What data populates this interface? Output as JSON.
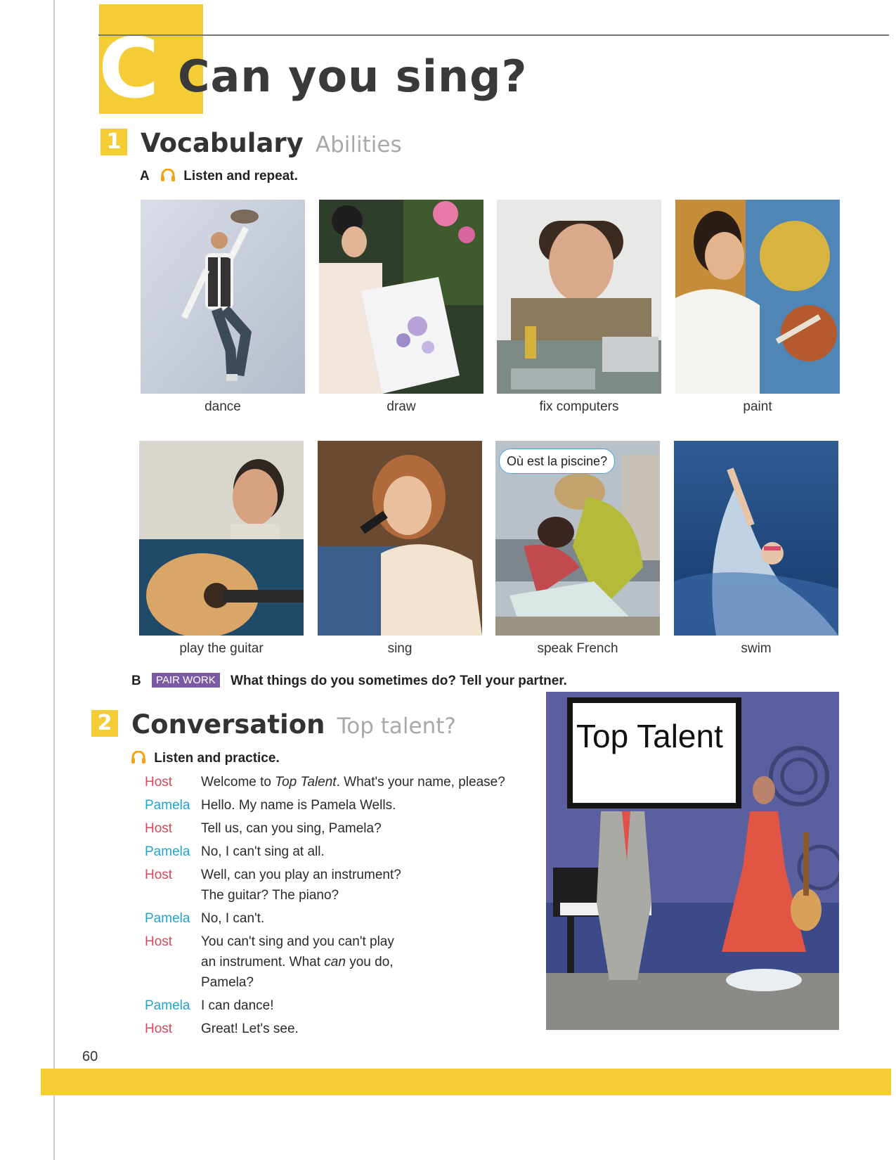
{
  "unit": {
    "letter": "C",
    "title": "Can you sing?"
  },
  "section1": {
    "number": "1",
    "title": "Vocabulary",
    "subtitle": "Abilities",
    "partA": {
      "letter": "A",
      "instruction": "Listen and repeat."
    },
    "items": [
      {
        "label": "dance"
      },
      {
        "label": "draw"
      },
      {
        "label": "fix computers"
      },
      {
        "label": "paint"
      },
      {
        "label": "play the guitar"
      },
      {
        "label": "sing"
      },
      {
        "label": "speak French",
        "speech_bubble": "Où est la piscine?"
      },
      {
        "label": "swim"
      }
    ],
    "partB": {
      "letter": "B",
      "badge": "PAIR WORK",
      "instruction": "What things do you sometimes do? Tell your partner."
    }
  },
  "section2": {
    "number": "2",
    "title": "Conversation",
    "subtitle": "Top talent?",
    "instruction": "Listen and practice.",
    "sign": "Top Talent",
    "dialogue": [
      {
        "speaker": "Host",
        "lines": [
          "Welcome to <i>Top Talent</i>. What's your name, please?"
        ]
      },
      {
        "speaker": "Pamela",
        "lines": [
          "Hello. My name is Pamela Wells."
        ]
      },
      {
        "speaker": "Host",
        "lines": [
          "Tell us, can you sing, Pamela?"
        ]
      },
      {
        "speaker": "Pamela",
        "lines": [
          "No, I can't sing at all."
        ]
      },
      {
        "speaker": "Host",
        "lines": [
          "Well, can you play an instrument?",
          "The guitar? The piano?"
        ]
      },
      {
        "speaker": "Pamela",
        "lines": [
          "No, I can't."
        ]
      },
      {
        "speaker": "Host",
        "lines": [
          "You can't sing and you can't play",
          "an instrument. What <i>can</i> you do,",
          "Pamela?"
        ]
      },
      {
        "speaker": "Pamela",
        "lines": [
          "I can dance!"
        ]
      },
      {
        "speaker": "Host",
        "lines": [
          "Great! Let's see."
        ]
      }
    ]
  },
  "page_number": "60"
}
